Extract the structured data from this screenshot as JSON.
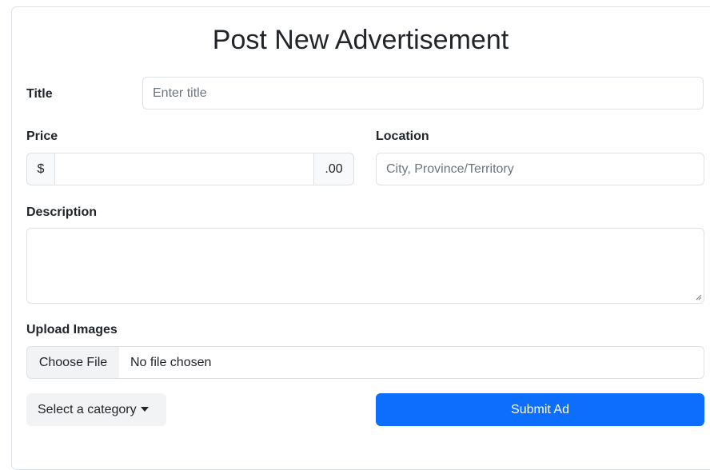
{
  "form": {
    "heading": "Post New Advertisement",
    "title": {
      "label": "Title",
      "placeholder": "Enter title"
    },
    "price": {
      "label": "Price",
      "prefix": "$",
      "suffix": ".00",
      "value": ""
    },
    "location": {
      "label": "Location",
      "placeholder": "City, Province/Territory"
    },
    "description": {
      "label": "Description",
      "value": ""
    },
    "upload": {
      "label": "Upload Images",
      "button_label": "Choose File",
      "status": "No file chosen"
    },
    "category": {
      "label": "Select a category"
    },
    "submit": {
      "label": "Submit Ad"
    }
  },
  "colors": {
    "primary": "#0d6efd",
    "border": "#dee2e6",
    "addon_bg": "#f8f9fa",
    "button_bg": "#f1f3f5"
  }
}
